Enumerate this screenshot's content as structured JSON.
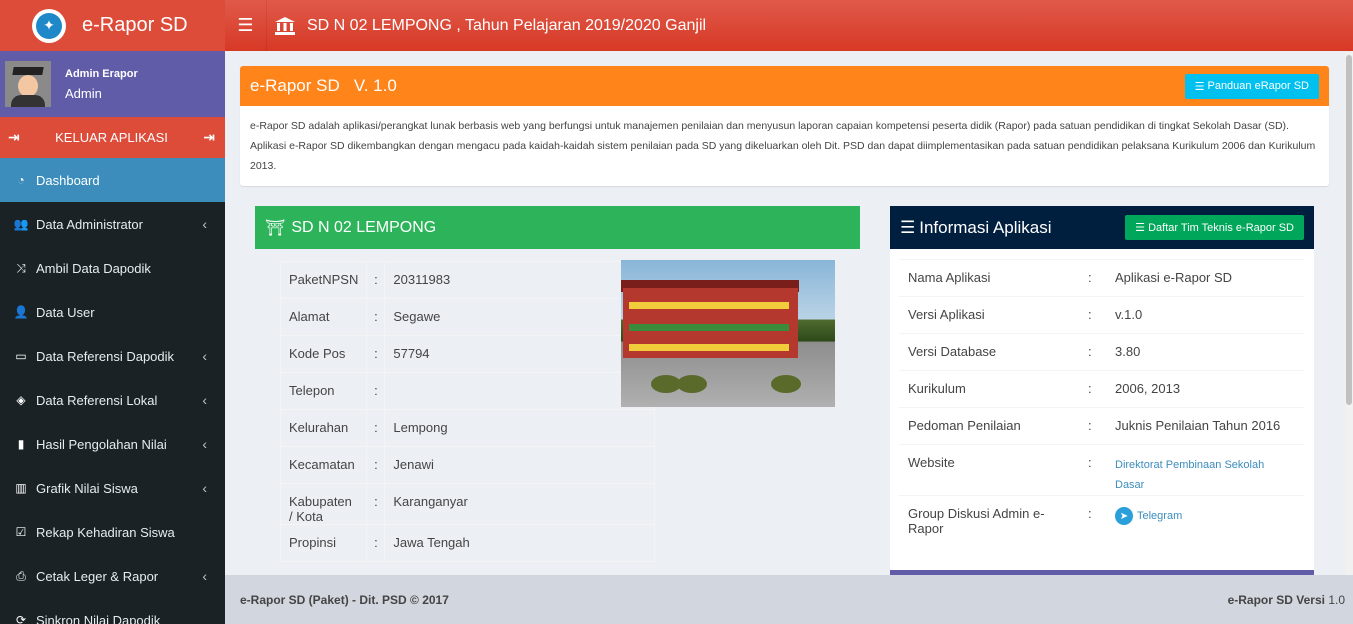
{
  "app": {
    "brand": "e-Rapor SD"
  },
  "navbar": {
    "title": "SD N 02 LEMPONG  , Tahun Pelajaran 2019/2020 Ganjil"
  },
  "user": {
    "name": "Admin Erapor",
    "role": "Admin"
  },
  "logout_label": "KELUAR APLIKASI",
  "menu": [
    {
      "label": "Dashboard",
      "icon": "dashboard-icon",
      "chevron": false,
      "active": true
    },
    {
      "label": "Data Administrator",
      "icon": "users-icon",
      "chevron": true
    },
    {
      "label": "Ambil Data Dapodik",
      "icon": "random-icon",
      "chevron": false
    },
    {
      "label": "Data User",
      "icon": "user-group-icon",
      "chevron": false
    },
    {
      "label": "Data Referensi Dapodik",
      "icon": "desktop-icon",
      "chevron": true
    },
    {
      "label": "Data Referensi Lokal",
      "icon": "tags-icon",
      "chevron": true
    },
    {
      "label": "Hasil Pengolahan Nilai",
      "icon": "book-icon",
      "chevron": true
    },
    {
      "label": "Grafik Nilai Siswa",
      "icon": "bar-chart-icon",
      "chevron": true
    },
    {
      "label": "Rekap Kehadiran Siswa",
      "icon": "check-square-icon",
      "chevron": false
    },
    {
      "label": "Cetak Leger & Rapor",
      "icon": "print-icon",
      "chevron": true
    },
    {
      "label": "Sinkron Nilai Dapodik",
      "icon": "sync-icon",
      "chevron": false
    }
  ],
  "intro": {
    "title": "e-Rapor SD   V. 1.0",
    "button": "Panduan eRapor SD",
    "text": "e-Rapor SD adalah aplikasi/perangkat lunak berbasis web yang berfungsi untuk manajemen penilaian dan menyusun laporan capaian kompetensi peserta didik (Rapor) pada satuan pendidikan di tingkat Sekolah Dasar (SD). Aplikasi e-Rapor SD dikembangkan dengan mengacu pada kaidah-kaidah sistem penilaian pada SD yang dikeluarkan oleh Dit. PSD dan dapat diimplementasikan pada satuan pendidikan pelaksana Kurikulum 2006 dan Kurikulum 2013."
  },
  "school": {
    "title": "SD N 02 LEMPONG",
    "rows": [
      {
        "label": "PaketNPSN",
        "value": "20311983"
      },
      {
        "label": "Alamat",
        "value": "Segawe"
      },
      {
        "label": "Kode Pos",
        "value": "57794"
      },
      {
        "label": "Telepon",
        "value": ""
      },
      {
        "label": "Kelurahan",
        "value": "Lempong"
      },
      {
        "label": "Kecamatan",
        "value": "Jenawi"
      },
      {
        "label": "Kabupaten / Kota",
        "value": "Karanganyar"
      },
      {
        "label": "Propinsi",
        "value": "Jawa Tengah"
      }
    ]
  },
  "info": {
    "title": "Informasi Aplikasi",
    "button": "Daftar Tim Teknis e-Rapor SD",
    "rows": [
      {
        "label": "Nama Aplikasi",
        "value": "Aplikasi e-Rapor SD"
      },
      {
        "label": "Versi Aplikasi",
        "value": "v.1.0"
      },
      {
        "label": "Versi Database",
        "value": "3.80"
      },
      {
        "label": "Kurikulum",
        "value": "2006, 2013"
      },
      {
        "label": "Pedoman Penilaian",
        "value": "Juknis Penilaian Tahun 2016"
      },
      {
        "label": "Website",
        "value": "Direktorat Pembinaan Sekolah Dasar",
        "link": true
      },
      {
        "label": "Group Diskusi Admin e-Rapor",
        "value": "Telegram",
        "telegram": true
      }
    ]
  },
  "footer": {
    "left": "e-Rapor SD (Paket) - Dit. PSD © 2017",
    "right_bold": "e-Rapor SD Versi",
    "right_version": "1.0"
  },
  "colors": {
    "header": "#dd4b39",
    "sidebar": "#1a2226",
    "active": "#3c8dbc",
    "user_panel": "#605ca8",
    "orange": "#ff851b",
    "green": "#2db45a",
    "navy": "#001f3f"
  }
}
